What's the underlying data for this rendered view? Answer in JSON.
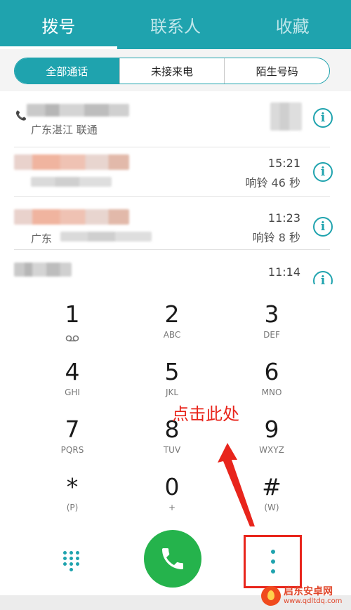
{
  "top_tabs": [
    {
      "label": "拨号",
      "active": true
    },
    {
      "label": "联系人",
      "active": false
    },
    {
      "label": "收藏",
      "active": false
    }
  ],
  "filters": [
    {
      "label": "全部通话",
      "active": true
    },
    {
      "label": "未接来电",
      "active": false
    },
    {
      "label": "陌生号码",
      "active": false
    }
  ],
  "calls": [
    {
      "location": "广东湛江 联通",
      "time": "",
      "ring": "",
      "blurred_name": true
    },
    {
      "location": "",
      "time": "15:21",
      "ring": "响铃 46 秒",
      "blurred_name": true
    },
    {
      "location": "广东",
      "time": "11:23",
      "ring": "响铃 8 秒",
      "blurred_name": true
    },
    {
      "location": "",
      "time": "11:14",
      "ring": "",
      "blurred_name": true
    }
  ],
  "keys": [
    {
      "digit": "1",
      "sub": ""
    },
    {
      "digit": "2",
      "sub": "ABC"
    },
    {
      "digit": "3",
      "sub": "DEF"
    },
    {
      "digit": "4",
      "sub": "GHI"
    },
    {
      "digit": "5",
      "sub": "JKL"
    },
    {
      "digit": "6",
      "sub": "MNO"
    },
    {
      "digit": "7",
      "sub": "PQRS"
    },
    {
      "digit": "8",
      "sub": "TUV"
    },
    {
      "digit": "9",
      "sub": "WXYZ"
    },
    {
      "digit": "*",
      "sub": "(P)"
    },
    {
      "digit": "0",
      "sub": "+"
    },
    {
      "digit": "#",
      "sub": "(W)"
    }
  ],
  "annotation": "点击此处",
  "watermark": {
    "name": "启东安卓网",
    "url": "www.qdltdq.com"
  },
  "colors": {
    "accent": "#1fa3ae",
    "call_green": "#25b34c",
    "annotation_red": "#e8251c"
  },
  "icons": {
    "voicemail": "voicemail-icon",
    "info": "info-icon",
    "keypad": "keypad-icon",
    "call": "phone-icon",
    "more": "more-vertical-icon"
  }
}
